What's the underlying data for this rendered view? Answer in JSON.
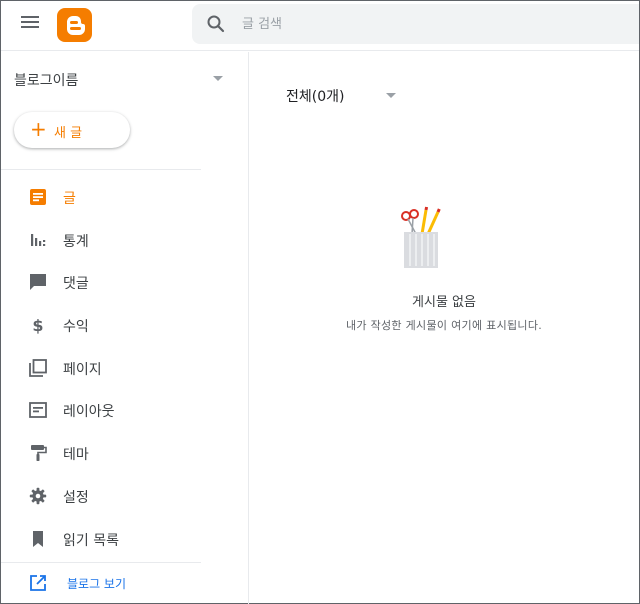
{
  "colors": {
    "accent": "#f57d00",
    "icon_gray": "#5f6368",
    "link": "#1a73e8"
  },
  "header": {
    "menu_icon": "hamburger-menu-icon",
    "logo_icon": "blogger-logo-icon",
    "search": {
      "placeholder": "글 검색",
      "value": "",
      "icon": "search-icon"
    }
  },
  "sidebar": {
    "blog_name": "블로그이름",
    "new_post_label": "새 글",
    "items": [
      {
        "label": "글",
        "icon": "posts-icon",
        "active": true
      },
      {
        "label": "통계",
        "icon": "stats-icon",
        "active": false
      },
      {
        "label": "댓글",
        "icon": "comments-icon",
        "active": false
      },
      {
        "label": "수익",
        "icon": "earnings-icon",
        "active": false
      },
      {
        "label": "페이지",
        "icon": "pages-icon",
        "active": false
      },
      {
        "label": "레이아웃",
        "icon": "layout-icon",
        "active": false
      },
      {
        "label": "테마",
        "icon": "theme-icon",
        "active": false
      },
      {
        "label": "설정",
        "icon": "settings-icon",
        "active": false
      },
      {
        "label": "읽기 목록",
        "icon": "reading-list-icon",
        "active": false
      }
    ],
    "view_blog_label": "블로그 보기"
  },
  "main": {
    "filter_label": "전체(0개)",
    "empty_title": "게시물 없음",
    "empty_desc": "내가 작성한 게시물이 여기에 표시됩니다."
  }
}
